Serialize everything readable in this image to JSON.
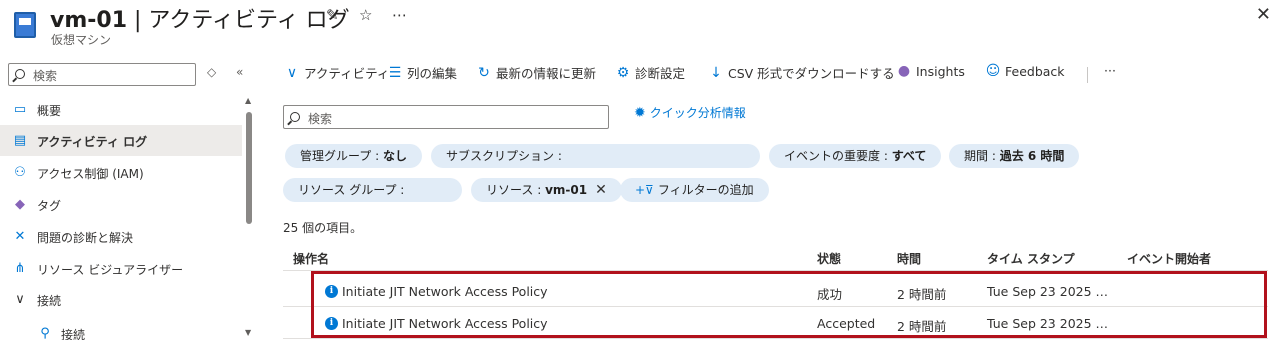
{
  "header": {
    "title_name": "vm-01",
    "title_sep": " | ",
    "title_page": "アクティビティ ログ",
    "subtitle": "仮想マシン",
    "pin_icon": "pin-icon",
    "favorite_icon": "star-icon",
    "more_icon": "ellipsis-icon",
    "close_icon": "close-icon"
  },
  "sidebar": {
    "search_placeholder": "検索",
    "items": [
      {
        "label": "概要",
        "icon": "monitor-icon"
      },
      {
        "label": "アクティビティ ログ",
        "icon": "log-icon",
        "active": true
      },
      {
        "label": "アクセス制御 (IAM)",
        "icon": "people-icon"
      },
      {
        "label": "タグ",
        "icon": "tag-icon"
      },
      {
        "label": "問題の診断と解決",
        "icon": "wrench-icon"
      },
      {
        "label": "リソース ビジュアライザー",
        "icon": "hierarchy-icon"
      },
      {
        "label": "接続",
        "icon": "chevron-down-icon"
      },
      {
        "label": "接続",
        "icon": "plug-icon"
      }
    ]
  },
  "toolbar": {
    "activity": "アクティビティ",
    "edit_columns": "列の編集",
    "refresh": "最新の情報に更新",
    "diagnostic": "診断設定",
    "download_csv": "CSV 形式でダウンロードする",
    "insights": "Insights",
    "feedback": "Feedback",
    "more": "···"
  },
  "search": {
    "placeholder": "検索"
  },
  "quick_insights": "クイック分析情報",
  "filters": {
    "mgmt_group_key": "管理グループ : ",
    "mgmt_group_val": "なし",
    "subscription_key": "サブスクリプション : ",
    "severity_key": "イベントの重要度 : ",
    "severity_val": "すべて",
    "timespan_key": "期間 : ",
    "timespan_val": "過去 6 時間",
    "resource_group_key": "リソース グループ : ",
    "resource_key": "リソース : ",
    "resource_val": "vm-01",
    "add_filter": "フィルターの追加"
  },
  "item_count": "25 個の項目。",
  "table": {
    "headers": {
      "operation": "操作名",
      "status": "状態",
      "time": "時間",
      "timestamp": "タイム スタンプ",
      "initiator": "イベント開始者"
    },
    "rows": [
      {
        "operation": "Initiate JIT Network Access Policy",
        "status": "成功",
        "time": "2 時間前",
        "timestamp": "Tue Sep 23 2025 …",
        "initiator": ""
      },
      {
        "operation": "Initiate JIT Network Access Policy",
        "status": "Accepted",
        "time": "2 時間前",
        "timestamp": "Tue Sep 23 2025 …",
        "initiator": ""
      }
    ]
  },
  "colors": {
    "accent": "#0078d4",
    "pill": "#e1ecf7",
    "highlight": "#b1111c"
  }
}
